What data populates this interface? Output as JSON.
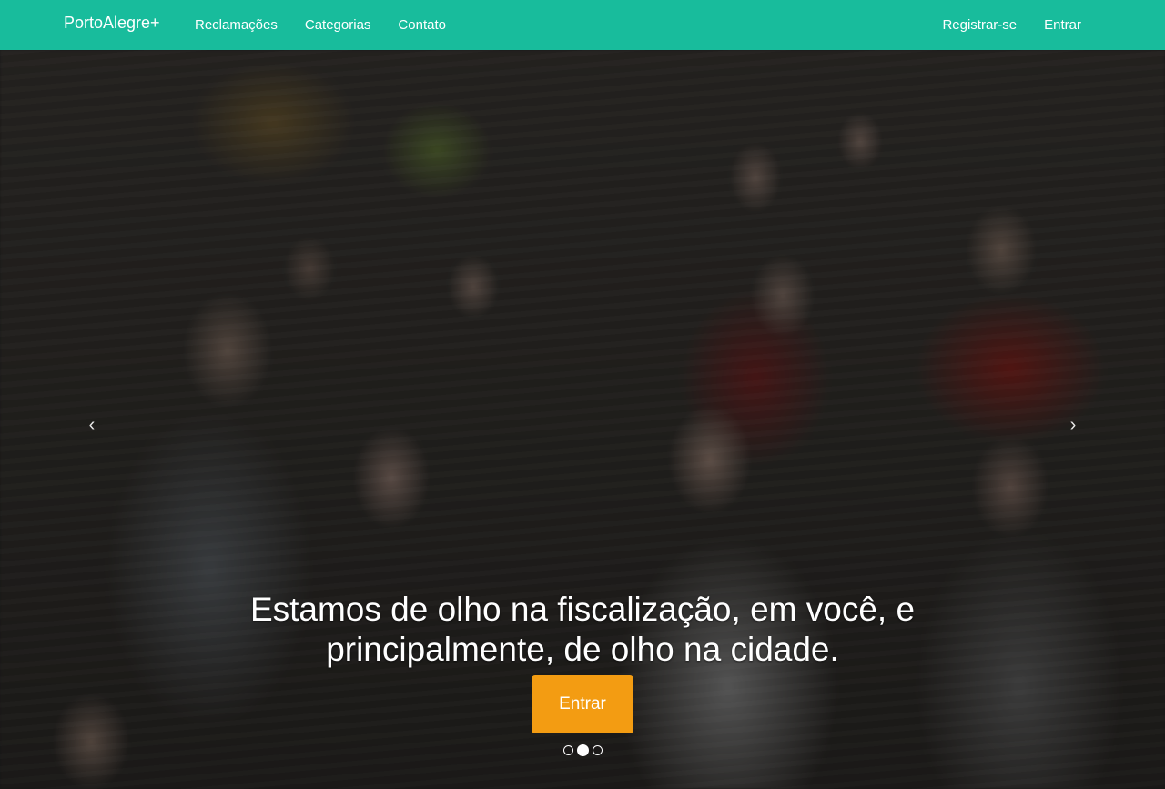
{
  "navbar": {
    "brand": "PortoAlegre+",
    "left_links": [
      {
        "label": "Reclamações"
      },
      {
        "label": "Categorias"
      },
      {
        "label": "Contato"
      }
    ],
    "right_links": [
      {
        "label": "Registrar-se"
      },
      {
        "label": "Entrar"
      }
    ],
    "background_color": "#18bc9c"
  },
  "hero": {
    "caption": "Estamos de olho na fiscalização, em você, e principalmente, de olho na cidade.",
    "cta_label": "Entrar",
    "cta_color": "#f39c12",
    "prev_arrow": "‹",
    "next_arrow": "›",
    "slide_count": 3,
    "active_slide": 2
  }
}
